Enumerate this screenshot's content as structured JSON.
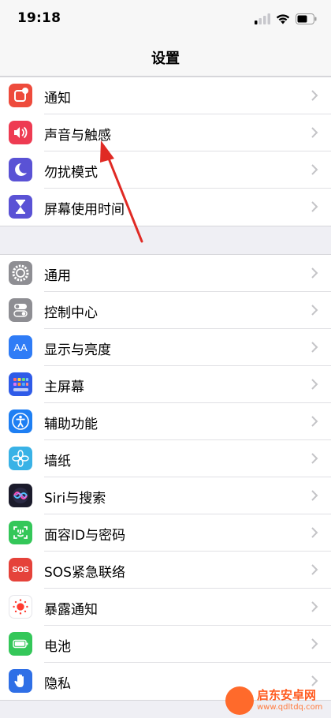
{
  "status_bar": {
    "time": "19:18"
  },
  "nav": {
    "title": "设置"
  },
  "colors": {
    "notifications": "#ee4b3c",
    "sounds": "#ee3b52",
    "focus": "#5a52d5",
    "screen_time": "#5a52d5",
    "general": "#8e8e93",
    "control_center": "#8e8e93",
    "display": "#2f7cf6",
    "home_screen": "#2f5be8",
    "accessibility": "#1e7ff3",
    "wallpaper": "#39b2e6",
    "siri": "#1b1b2b",
    "face_id": "#34c759",
    "sos": "#e5423a",
    "exposure": "#ffffff",
    "battery": "#34c759",
    "privacy": "#2f6fe6",
    "chevron": "#c4c4c7",
    "arrow": "#e02a24"
  },
  "group1": [
    {
      "label": "通知",
      "icon": "notification-icon"
    },
    {
      "label": "声音与触感",
      "icon": "speaker-icon"
    },
    {
      "label": "勿扰模式",
      "icon": "moon-icon"
    },
    {
      "label": "屏幕使用时间",
      "icon": "hourglass-icon"
    }
  ],
  "group2": [
    {
      "label": "通用",
      "icon": "gear-icon"
    },
    {
      "label": "控制中心",
      "icon": "toggles-icon"
    },
    {
      "label": "显示与亮度",
      "icon": "text-size-icon"
    },
    {
      "label": "主屏幕",
      "icon": "home-grid-icon"
    },
    {
      "label": "辅助功能",
      "icon": "accessibility-icon"
    },
    {
      "label": "墙纸",
      "icon": "flower-icon"
    },
    {
      "label": "Siri与搜索",
      "icon": "siri-icon"
    },
    {
      "label": "面容ID与密码",
      "icon": "face-id-icon"
    },
    {
      "label": "SOS紧急联络",
      "icon": "sos-icon",
      "icon_text": "SOS"
    },
    {
      "label": "暴露通知",
      "icon": "exposure-icon"
    },
    {
      "label": "电池",
      "icon": "battery-icon"
    },
    {
      "label": "隐私",
      "icon": "hand-icon"
    }
  ],
  "icons_text": {
    "display": "AA"
  },
  "watermark": {
    "name": "启东安卓网",
    "url": "www.qdltdq.com"
  }
}
